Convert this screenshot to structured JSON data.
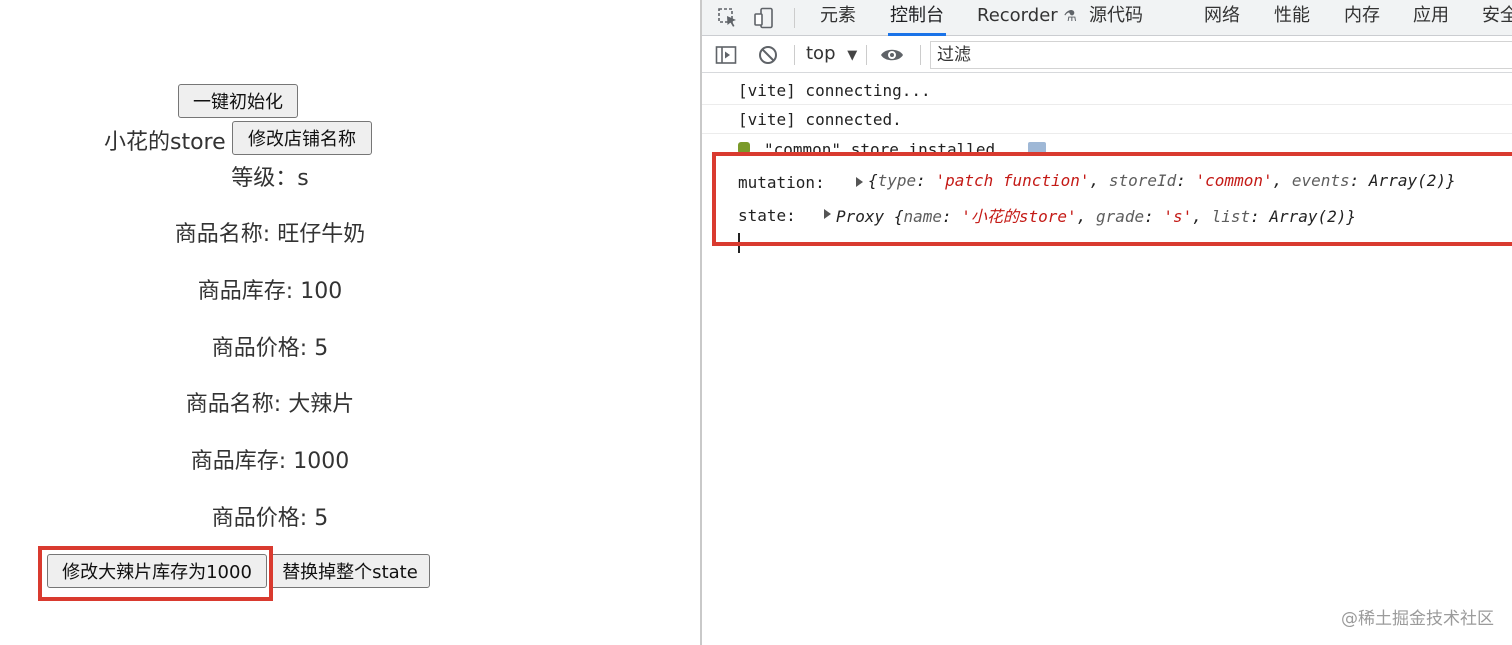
{
  "app": {
    "init_button": "一键初始化",
    "store_name": "小花的store",
    "rename_button": "修改店铺名称",
    "grade_text": "等级：s",
    "products": [
      {
        "name_line": "商品名称: 旺仔牛奶",
        "stock_line": "商品库存: 100",
        "price_line": "商品价格: 5"
      },
      {
        "name_line": "商品名称: 大辣片",
        "stock_line": "商品库存: 1000",
        "price_line": "商品价格: 5"
      }
    ],
    "modify_stock_button": "修改大辣片库存为1000",
    "replace_state_button": "替换掉整个state",
    "highlight_color": "#d93a2f"
  },
  "devtools": {
    "tabs": [
      "元素",
      "控制台",
      "Recorder",
      "源代码",
      "网络",
      "性能",
      "内存",
      "应用",
      "安全"
    ],
    "active_tab": "控制台",
    "recorder_flask": "⚗",
    "context_select": "top",
    "filter_placeholder": "过滤",
    "console": {
      "vite_connecting": "[vite] connecting...",
      "vite_connected": "[vite] connected.",
      "store_installed": "\"common\" store installed",
      "mutation_label": "mutation:",
      "mutation_obj": {
        "open": "{",
        "type_key": "type",
        "type_val": "'patch function'",
        "store_key": "storeId",
        "store_val": "'common'",
        "events_key": "events",
        "events_val": "Array(2)",
        "close": "}"
      },
      "state_label": "state:",
      "state_obj": {
        "proxy": "Proxy",
        "open": "{",
        "name_key": "name",
        "name_val": "'小花的store'",
        "grade_key": "grade",
        "grade_val": "'s'",
        "list_key": "list",
        "list_val": "Array(2)",
        "close": "}"
      }
    }
  },
  "watermark": "@稀土掘金技术社区"
}
